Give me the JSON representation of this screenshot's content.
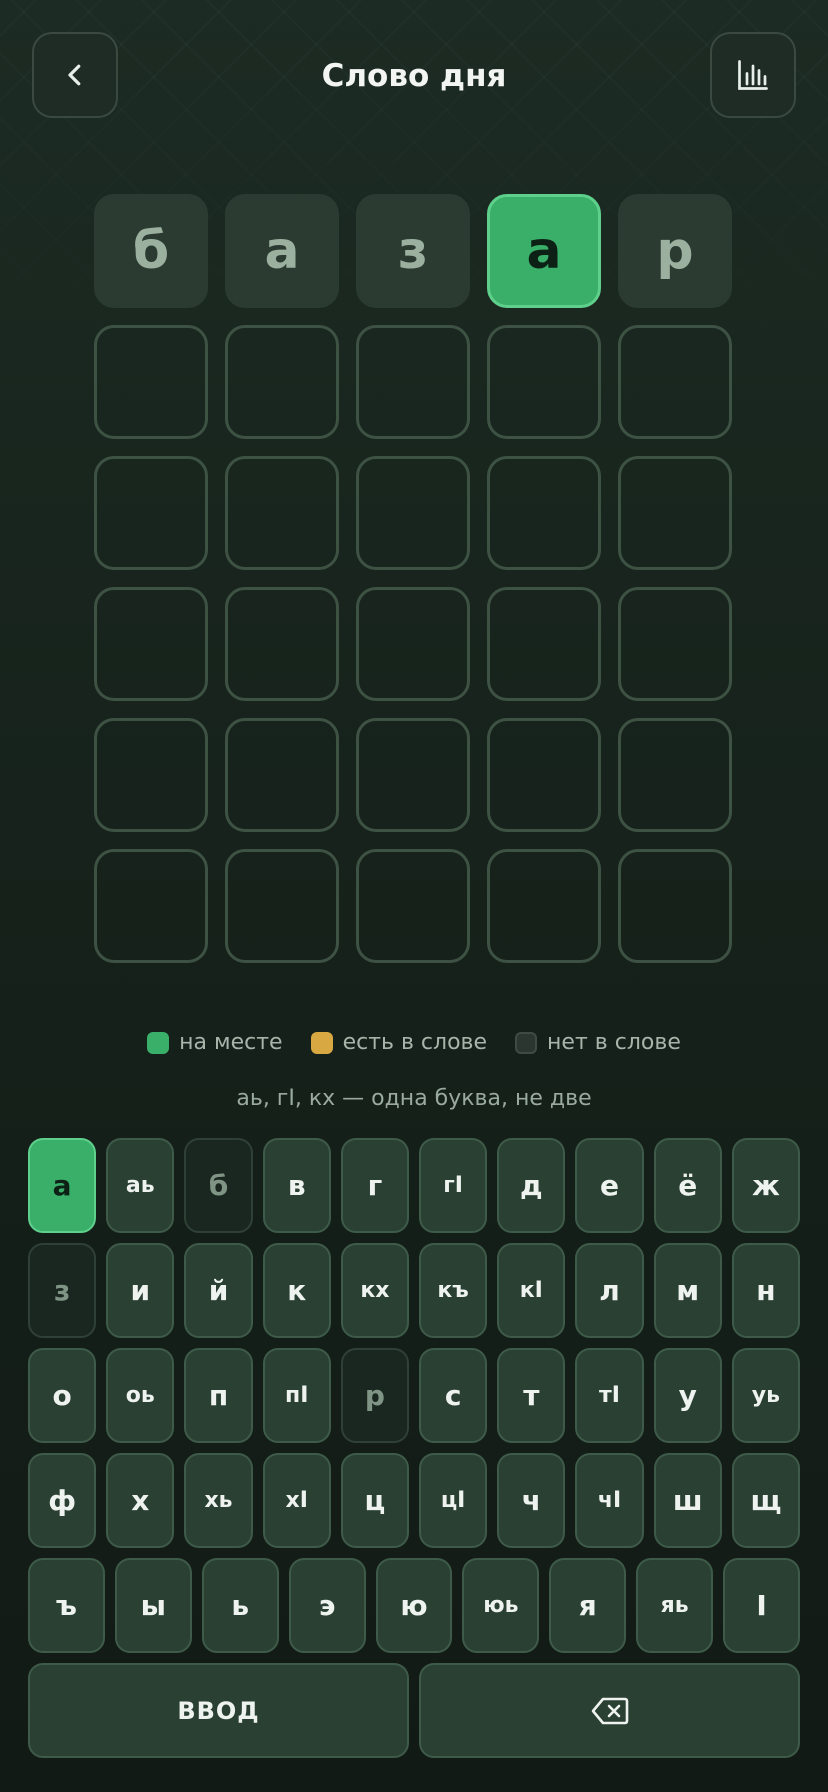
{
  "header": {
    "title": "Слово дня",
    "back_icon": "chevron-left-icon",
    "stats_icon": "bar-chart-icon"
  },
  "colors": {
    "correct": "#3aaf6a",
    "present": "#d8a843",
    "absent": "#2b3b31",
    "key": "#2a4033"
  },
  "board": {
    "rows": [
      [
        {
          "letter": "б",
          "state": "absent"
        },
        {
          "letter": "а",
          "state": "absent"
        },
        {
          "letter": "з",
          "state": "absent"
        },
        {
          "letter": "а",
          "state": "correct"
        },
        {
          "letter": "р",
          "state": "absent"
        }
      ],
      [
        {
          "letter": "",
          "state": "empty"
        },
        {
          "letter": "",
          "state": "empty"
        },
        {
          "letter": "",
          "state": "empty"
        },
        {
          "letter": "",
          "state": "empty"
        },
        {
          "letter": "",
          "state": "empty"
        }
      ],
      [
        {
          "letter": "",
          "state": "empty"
        },
        {
          "letter": "",
          "state": "empty"
        },
        {
          "letter": "",
          "state": "empty"
        },
        {
          "letter": "",
          "state": "empty"
        },
        {
          "letter": "",
          "state": "empty"
        }
      ],
      [
        {
          "letter": "",
          "state": "empty"
        },
        {
          "letter": "",
          "state": "empty"
        },
        {
          "letter": "",
          "state": "empty"
        },
        {
          "letter": "",
          "state": "empty"
        },
        {
          "letter": "",
          "state": "empty"
        }
      ],
      [
        {
          "letter": "",
          "state": "empty"
        },
        {
          "letter": "",
          "state": "empty"
        },
        {
          "letter": "",
          "state": "empty"
        },
        {
          "letter": "",
          "state": "empty"
        },
        {
          "letter": "",
          "state": "empty"
        }
      ],
      [
        {
          "letter": "",
          "state": "empty"
        },
        {
          "letter": "",
          "state": "empty"
        },
        {
          "letter": "",
          "state": "empty"
        },
        {
          "letter": "",
          "state": "empty"
        },
        {
          "letter": "",
          "state": "empty"
        }
      ]
    ]
  },
  "legend": {
    "correct": "на месте",
    "present": "есть в слове",
    "absent": "нет в слове"
  },
  "hint": "аь, гӀ, кх — одна буква, не две",
  "keyboard": {
    "rows": [
      [
        {
          "label": "а",
          "state": "correct"
        },
        {
          "label": "аь",
          "state": "default"
        },
        {
          "label": "б",
          "state": "absent"
        },
        {
          "label": "в",
          "state": "default"
        },
        {
          "label": "г",
          "state": "default"
        },
        {
          "label": "гӀ",
          "state": "default"
        },
        {
          "label": "д",
          "state": "default"
        },
        {
          "label": "е",
          "state": "default"
        },
        {
          "label": "ё",
          "state": "default"
        },
        {
          "label": "ж",
          "state": "default"
        }
      ],
      [
        {
          "label": "з",
          "state": "absent"
        },
        {
          "label": "и",
          "state": "default"
        },
        {
          "label": "й",
          "state": "default"
        },
        {
          "label": "к",
          "state": "default"
        },
        {
          "label": "кх",
          "state": "default"
        },
        {
          "label": "къ",
          "state": "default"
        },
        {
          "label": "кӀ",
          "state": "default"
        },
        {
          "label": "л",
          "state": "default"
        },
        {
          "label": "м",
          "state": "default"
        },
        {
          "label": "н",
          "state": "default"
        }
      ],
      [
        {
          "label": "о",
          "state": "default"
        },
        {
          "label": "оь",
          "state": "default"
        },
        {
          "label": "п",
          "state": "default"
        },
        {
          "label": "пӀ",
          "state": "default"
        },
        {
          "label": "р",
          "state": "absent"
        },
        {
          "label": "с",
          "state": "default"
        },
        {
          "label": "т",
          "state": "default"
        },
        {
          "label": "тӀ",
          "state": "default"
        },
        {
          "label": "у",
          "state": "default"
        },
        {
          "label": "уь",
          "state": "default"
        }
      ],
      [
        {
          "label": "ф",
          "state": "default"
        },
        {
          "label": "х",
          "state": "default"
        },
        {
          "label": "хь",
          "state": "default"
        },
        {
          "label": "хӀ",
          "state": "default"
        },
        {
          "label": "ц",
          "state": "default"
        },
        {
          "label": "цӀ",
          "state": "default"
        },
        {
          "label": "ч",
          "state": "default"
        },
        {
          "label": "чӀ",
          "state": "default"
        },
        {
          "label": "ш",
          "state": "default"
        },
        {
          "label": "щ",
          "state": "default"
        }
      ],
      [
        {
          "label": "ъ",
          "state": "default"
        },
        {
          "label": "ы",
          "state": "default"
        },
        {
          "label": "ь",
          "state": "default"
        },
        {
          "label": "э",
          "state": "default"
        },
        {
          "label": "ю",
          "state": "default"
        },
        {
          "label": "юь",
          "state": "default"
        },
        {
          "label": "я",
          "state": "default"
        },
        {
          "label": "яь",
          "state": "default"
        },
        {
          "label": "Ӏ",
          "state": "default"
        }
      ]
    ],
    "enter_label": "ВВОД",
    "backspace_icon": "backspace-icon"
  }
}
